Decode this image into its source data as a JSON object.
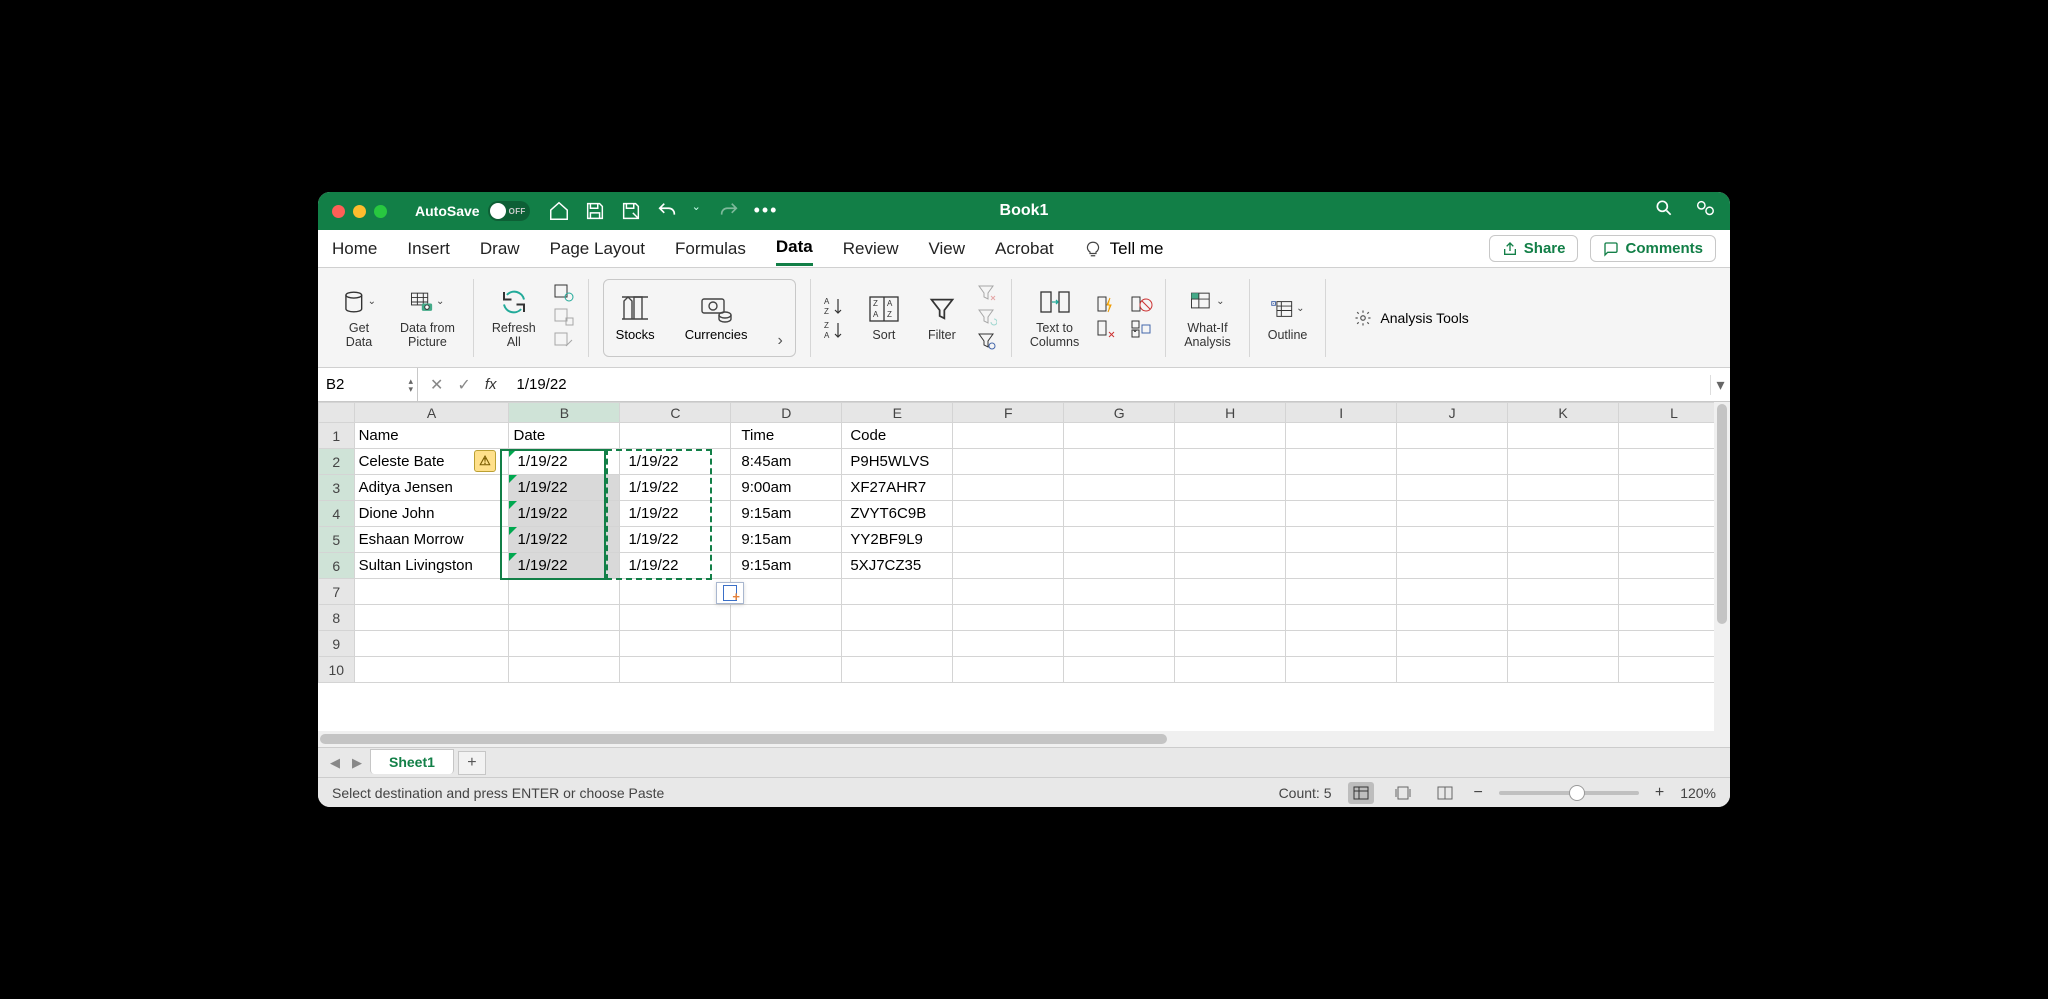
{
  "titlebar": {
    "autosave_label": "AutoSave",
    "autosave_state": "OFF",
    "title": "Book1"
  },
  "tabs": {
    "items": [
      "Home",
      "Insert",
      "Draw",
      "Page Layout",
      "Formulas",
      "Data",
      "Review",
      "View",
      "Acrobat"
    ],
    "active": "Data",
    "tellme": "Tell me",
    "share": "Share",
    "comments": "Comments"
  },
  "ribbon": {
    "get_data": "Get\nData",
    "data_from_picture": "Data from\nPicture",
    "refresh_all": "Refresh\nAll",
    "stocks": "Stocks",
    "currencies": "Currencies",
    "sort": "Sort",
    "filter": "Filter",
    "text_to_columns": "Text to\nColumns",
    "whatif": "What-If\nAnalysis",
    "outline": "Outline",
    "analysis_tools": "Analysis Tools"
  },
  "formula_bar": {
    "name_box": "B2",
    "formula": "1/19/22"
  },
  "grid": {
    "columns": [
      "A",
      "B",
      "C",
      "D",
      "E",
      "F",
      "G",
      "H",
      "I",
      "J",
      "K",
      "L"
    ],
    "rows_shown": 10,
    "headers": {
      "A": "Name",
      "B": "Date",
      "C": "",
      "D": "Time",
      "E": "Code"
    },
    "data": [
      {
        "A": "Celeste Bate",
        "B": "1/19/22",
        "C": "1/19/22",
        "D": "8:45am",
        "E": "P9H5WLVS"
      },
      {
        "A": "Aditya Jensen",
        "B": "1/19/22",
        "C": "1/19/22",
        "D": "9:00am",
        "E": "XF27AHR7"
      },
      {
        "A": "Dione John",
        "B": "1/19/22",
        "C": "1/19/22",
        "D": "9:15am",
        "E": "ZVYT6C9B"
      },
      {
        "A": "Eshaan Morrow",
        "B": "1/19/22",
        "C": "1/19/22",
        "D": "9:15am",
        "E": "YY2BF9L9"
      },
      {
        "A": "Sultan Livingston",
        "B": "1/19/22",
        "C": "1/19/22",
        "D": "9:15am",
        "E": "5XJ7CZ35"
      }
    ],
    "selection": "B2:B6",
    "copied_range": "C2:C6"
  },
  "sheets": {
    "active": "Sheet1"
  },
  "status": {
    "message": "Select destination and press ENTER or choose Paste",
    "count_label": "Count: 5",
    "zoom": "120%"
  }
}
